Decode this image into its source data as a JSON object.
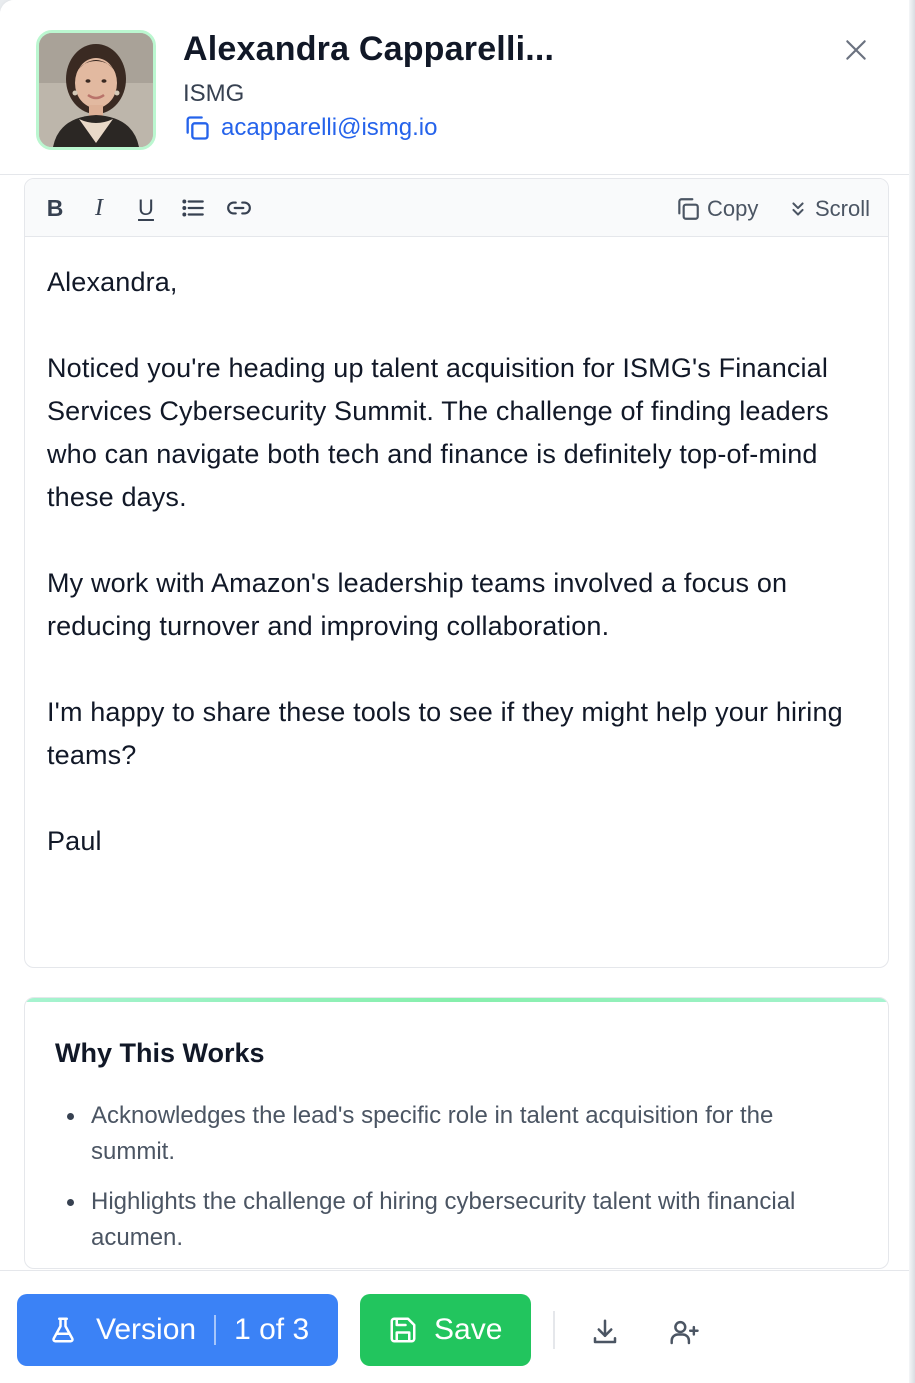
{
  "contact": {
    "name": "Alexandra Capparelli...",
    "company": "ISMG",
    "email": "acapparelli@ismg.io"
  },
  "toolbar": {
    "bold_label": "B",
    "italic_label": "I",
    "underline_label": "U",
    "copy_label": "Copy",
    "scroll_label": "Scroll"
  },
  "message": {
    "greeting": "Alexandra,",
    "paragraph1": "Noticed you're heading up talent acquisition for ISMG's Financial Services Cybersecurity Summit. The challenge of finding leaders who can navigate both tech and finance is definitely top-of-mind these days.",
    "paragraph2": "My work with Amazon's leadership teams involved a focus on reducing turnover and improving collaboration.",
    "paragraph3": "I'm happy to share these tools to see if they might help your hiring teams?",
    "signature": "Paul"
  },
  "why_this_works": {
    "title": "Why This Works",
    "items": [
      "Acknowledges the lead's specific role in talent acquisition for the summit.",
      "Highlights the challenge of hiring cybersecurity talent with financial acumen."
    ]
  },
  "footer": {
    "version_label": "Version",
    "version_count": "1 of 3",
    "save_label": "Save"
  },
  "icons": {
    "close": "close-icon",
    "copy_email": "copy-icon",
    "list": "list-icon",
    "link": "link-icon",
    "scroll": "chevrons-down-icon",
    "version": "flask-icon",
    "save": "save-icon",
    "download": "download-icon",
    "add_contact": "user-plus-icon"
  },
  "colors": {
    "accent_blue": "#3b82f6",
    "link_blue": "#2563eb",
    "save_green": "#22c55e",
    "avatar_border": "#bbf7d0"
  }
}
